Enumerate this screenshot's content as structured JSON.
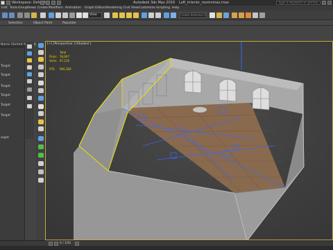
{
  "titlebar": {
    "workspace": "Workspace: Default",
    "app_title": "Autodesk 3ds Max 2016",
    "file_name": "Loft_interior_roomnmax.max",
    "search_placeholder": "Type a keyword or phrase"
  },
  "menu": [
    "Edit",
    "Tools",
    "Group",
    "Views",
    "Create",
    "Modifiers",
    "Animation",
    "Graph Editors",
    "Rendering",
    "Civil View",
    "Customize",
    "Scripting",
    "Help"
  ],
  "toolbar": {
    "view_dropdown": "View",
    "selection_set": "Create Selection Se"
  },
  "ribbon": [
    "Selection",
    "Object Paint",
    "Populate"
  ],
  "explorer": {
    "header": "Name (Sorted Ascending)",
    "items": [
      "Target",
      "Target",
      "Target",
      "Target",
      "Target",
      "Target",
      "arget"
    ]
  },
  "viewport": {
    "label": "[+] [Perspective ] [Shaded ]",
    "stats": {
      "total_label": "Total",
      "polys_label": "Polys:",
      "polys_value": "58,667",
      "verts_label": "Verts:",
      "verts_value": "67,130",
      "fps_label": "FPS:",
      "fps_value": "966,360"
    }
  },
  "timeline": {
    "counter": "0 / 100"
  },
  "colors": {
    "selection_outline": "#f0e000",
    "helper_lines": "#3a66ff",
    "stats_text": "#f0d000",
    "floor": "#8a6a4e",
    "walls": "#9a9a9a"
  }
}
